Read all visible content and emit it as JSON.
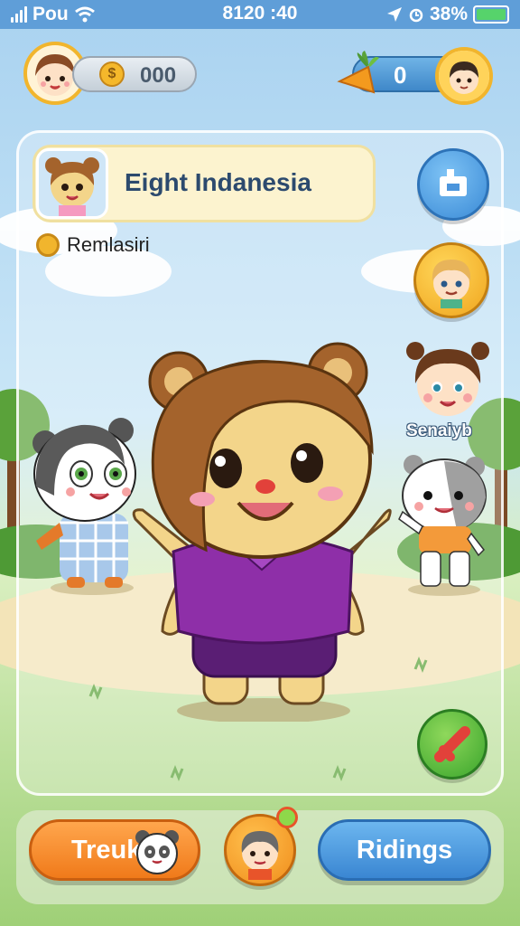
{
  "status_bar": {
    "carrier": "Pou",
    "time": "8120 :40",
    "battery_label": "38%",
    "battery_level": 1.0
  },
  "hud": {
    "coins": "000",
    "carrots": "0"
  },
  "profile": {
    "name": "Eight Indanesia",
    "subtitle": "Remlasiri"
  },
  "friends": {
    "label": "Senaiyb"
  },
  "bottom_bar": {
    "left_button": "Treuk",
    "right_button": "Ridings"
  },
  "colors": {
    "accent_blue": "#3a86d2",
    "accent_orange": "#f07a1a",
    "accent_gold": "#f0a51e",
    "accent_green": "#3aa52c",
    "bear_shirt": "#8e2fa8",
    "bear_fur": "#f3d58a",
    "bear_hair": "#a4632c"
  },
  "icons": {
    "coin": "coin-icon",
    "carrot": "carrot-icon",
    "edit": "edit-icon",
    "close": "close-icon"
  }
}
